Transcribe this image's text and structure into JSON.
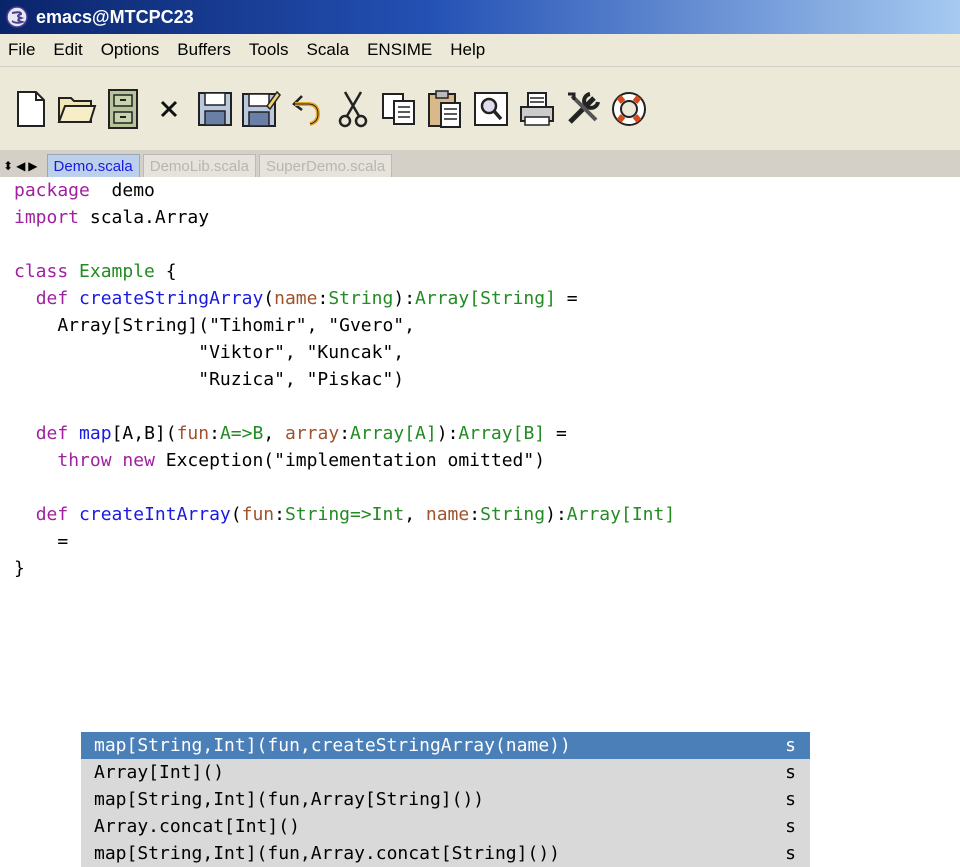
{
  "window": {
    "title": "emacs@MTCPC23"
  },
  "menu": [
    "File",
    "Edit",
    "Options",
    "Buffers",
    "Tools",
    "Scala",
    "ENSIME",
    "Help"
  ],
  "toolbar": {
    "buttons": [
      {
        "name": "new-file-icon"
      },
      {
        "name": "open-folder-icon"
      },
      {
        "name": "dired-cabinet-icon"
      },
      {
        "name": "close-x-icon"
      },
      {
        "name": "save-icon"
      },
      {
        "name": "save-as-icon"
      },
      {
        "name": "undo-icon"
      },
      {
        "name": "cut-icon"
      },
      {
        "name": "copy-icon"
      },
      {
        "name": "paste-icon"
      },
      {
        "name": "search-icon"
      },
      {
        "name": "print-icon"
      },
      {
        "name": "preferences-icon"
      },
      {
        "name": "help-lifebuoy-icon"
      }
    ]
  },
  "tabs": {
    "nav_icons": [
      "⬍",
      "◀",
      "▶"
    ],
    "items": [
      {
        "label": "Demo.scala",
        "active": true
      },
      {
        "label": "DemoLib.scala",
        "active": false
      },
      {
        "label": "SuperDemo.scala",
        "active": false
      }
    ]
  },
  "editor": {
    "lines": [
      [
        [
          "kw",
          "package"
        ],
        [
          "",
          "  demo"
        ]
      ],
      [
        [
          "kw",
          "import"
        ],
        [
          "",
          " scala.Array"
        ]
      ],
      [],
      [
        [
          "kw",
          "class"
        ],
        [
          "",
          " "
        ],
        [
          "ty",
          "Example"
        ],
        [
          "",
          " {"
        ]
      ],
      [
        [
          "",
          "  "
        ],
        [
          "kw",
          "def"
        ],
        [
          "",
          " "
        ],
        [
          "fn",
          "createStringArray"
        ],
        [
          "",
          "("
        ],
        [
          "param",
          "name"
        ],
        [
          "",
          ":"
        ],
        [
          "ty",
          "String"
        ],
        [
          "",
          "):"
        ],
        [
          "ty",
          "Array[String]"
        ],
        [
          "",
          " ="
        ]
      ],
      [
        [
          "",
          "    Array[String](\"Tihomir\", \"Gvero\","
        ]
      ],
      [
        [
          "",
          "                 \"Viktor\", \"Kuncak\","
        ]
      ],
      [
        [
          "",
          "                 \"Ruzica\", \"Piskac\")"
        ]
      ],
      [],
      [
        [
          "",
          "  "
        ],
        [
          "kw",
          "def"
        ],
        [
          "",
          " "
        ],
        [
          "fn",
          "map"
        ],
        [
          "",
          "[A,B]("
        ],
        [
          "param",
          "fun"
        ],
        [
          "",
          ":"
        ],
        [
          "ty",
          "A=>B"
        ],
        [
          "",
          ", "
        ],
        [
          "param",
          "array"
        ],
        [
          "",
          ":"
        ],
        [
          "ty",
          "Array[A]"
        ],
        [
          "",
          "):"
        ],
        [
          "ty",
          "Array[B]"
        ],
        [
          "",
          " ="
        ]
      ],
      [
        [
          "",
          "    "
        ],
        [
          "kw",
          "throw"
        ],
        [
          "",
          " "
        ],
        [
          "kw",
          "new"
        ],
        [
          "",
          " Exception(\"implementation omitted\")"
        ]
      ],
      [],
      [
        [
          "",
          "  "
        ],
        [
          "kw",
          "def"
        ],
        [
          "",
          " "
        ],
        [
          "fn",
          "createIntArray"
        ],
        [
          "",
          "("
        ],
        [
          "param",
          "fun"
        ],
        [
          "",
          ":"
        ],
        [
          "ty",
          "String=>Int"
        ],
        [
          "",
          ", "
        ],
        [
          "param",
          "name"
        ],
        [
          "",
          ":"
        ],
        [
          "ty",
          "String"
        ],
        [
          "",
          "):"
        ],
        [
          "ty",
          "Array[Int]"
        ]
      ],
      [
        [
          "",
          "    ="
        ]
      ],
      [
        [
          "",
          "}"
        ]
      ]
    ]
  },
  "completion": {
    "items": [
      {
        "text": "map[String,Int](fun,createStringArray(name))",
        "kind": "s",
        "selected": true
      },
      {
        "text": "Array[Int]()",
        "kind": "s",
        "selected": false
      },
      {
        "text": "map[String,Int](fun,Array[String]())",
        "kind": "s",
        "selected": false
      },
      {
        "text": "Array.concat[Int]()",
        "kind": "s",
        "selected": false
      },
      {
        "text": "map[String,Int](fun,Array.concat[String]())",
        "kind": "s",
        "selected": false
      }
    ]
  },
  "colors": {
    "keyword": "#a020a0",
    "type": "#228b22",
    "function": "#1a1ae0",
    "param": "#a0522d",
    "popup_selected": "#4b7fb8",
    "popup_bg": "#d9d9d9"
  }
}
